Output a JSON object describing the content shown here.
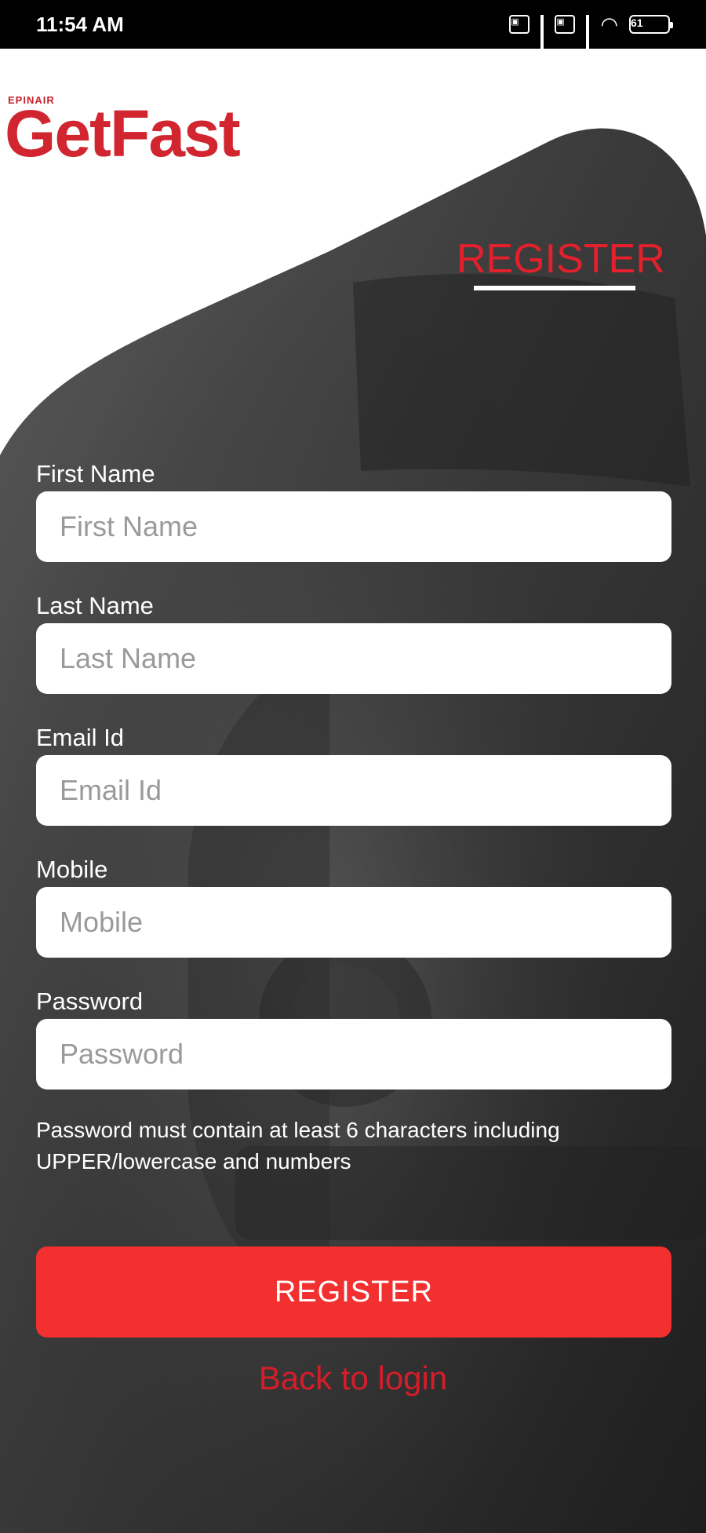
{
  "status_bar": {
    "time": "11:54 AM",
    "battery": "61"
  },
  "brand": {
    "tagline": "EPINAIR",
    "name": "GetFast"
  },
  "tab": {
    "label": "REGISTER"
  },
  "form": {
    "fields": [
      {
        "label": "First Name",
        "placeholder": "First Name"
      },
      {
        "label": "Last Name",
        "placeholder": "Last Name"
      },
      {
        "label": "Email Id",
        "placeholder": "Email Id"
      },
      {
        "label": "Mobile",
        "placeholder": "Mobile"
      },
      {
        "label": "Password",
        "placeholder": "Password"
      }
    ],
    "password_hint": "Password must contain at least 6 characters including UPPER/lowercase and numbers"
  },
  "actions": {
    "register_label": "REGISTER",
    "back_label": "Back to login"
  },
  "colors": {
    "accent": "#e3202b",
    "button": "#f1302f"
  }
}
